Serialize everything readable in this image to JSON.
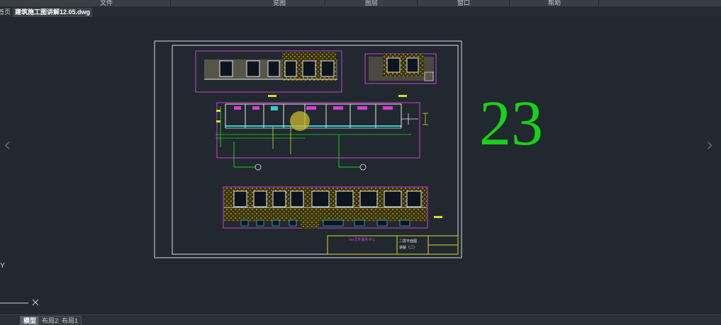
{
  "menubar": {
    "items": [
      {
        "label": "文件"
      },
      {
        "label": "览图"
      },
      {
        "label": "图层"
      },
      {
        "label": "窗口"
      },
      {
        "label": "帮助"
      }
    ]
  },
  "tabs": {
    "home": "首页",
    "document": "建筑施工图讲解12.05.dwg"
  },
  "drawing": {
    "overlay_number": "23",
    "title_block_org": "xxx文件服务中心",
    "title_block_title": "二层平面图",
    "title_block_subtitle": "讲解（二）",
    "y_label": "Y"
  },
  "layout_tabs": [
    "模型",
    "布局2",
    "布局1"
  ],
  "colors": {
    "background": "#212830",
    "accent_green": "#17d317",
    "magenta": "#d03fd0",
    "yellow": "#d8d82a",
    "cyan": "#30d0d0"
  }
}
